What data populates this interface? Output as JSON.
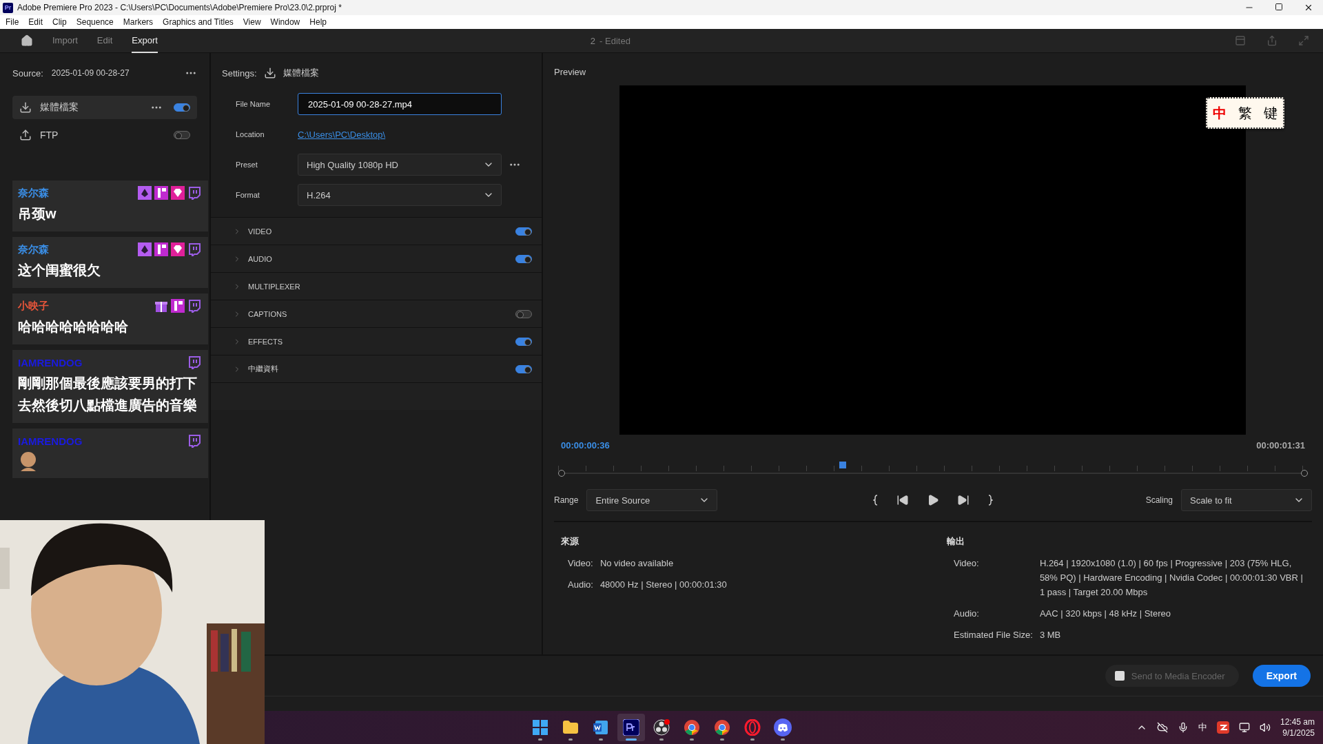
{
  "window": {
    "title": "Adobe Premiere Pro 2023 - C:\\Users\\PC\\Documents\\Adobe\\Premiere Pro\\23.0\\2.prproj *",
    "app_icon": "Pr"
  },
  "menu": [
    "File",
    "Edit",
    "Clip",
    "Sequence",
    "Markers",
    "Graphics and Titles",
    "View",
    "Window",
    "Help"
  ],
  "header": {
    "tabs": [
      {
        "label": "Import",
        "selected": false
      },
      {
        "label": "Edit",
        "selected": false
      },
      {
        "label": "Export",
        "selected": true
      }
    ],
    "document": "2",
    "status": "- Edited"
  },
  "source": {
    "label": "Source:",
    "value": "2025-01-09 00-28-27"
  },
  "destinations": [
    {
      "kind": "download",
      "label": "媒體檔案",
      "on": true,
      "selected": true
    },
    {
      "kind": "upload",
      "label": "FTP",
      "on": false,
      "selected": false
    }
  ],
  "settings": {
    "label": "Settings:",
    "destination": "媒體檔案",
    "fields": [
      {
        "kind": "input",
        "label": "File Name",
        "value": "2025-01-09 00-28-27.mp4"
      },
      {
        "kind": "link",
        "label": "Location",
        "value": "C:\\Users\\PC\\Desktop\\"
      },
      {
        "kind": "select",
        "label": "Preset",
        "value": "High Quality 1080p HD"
      },
      {
        "kind": "select",
        "label": "Format",
        "value": "H.264"
      }
    ],
    "sections": [
      {
        "label": "VIDEO",
        "on": true
      },
      {
        "label": "AUDIO",
        "on": true
      },
      {
        "label": "MULTIPLEXER"
      },
      {
        "label": "CAPTIONS",
        "on": false
      },
      {
        "label": "EFFECTS",
        "on": true
      },
      {
        "label": "中繼資料",
        "on": true
      }
    ]
  },
  "preview": {
    "title": "Preview",
    "current_time": "00:00:00:36",
    "duration": "00:00:01:31",
    "level": 0.38,
    "range": {
      "label": "Range",
      "value": "Entire Source"
    },
    "scaling": {
      "label": "Scaling",
      "value": "Scale to fit"
    }
  },
  "ime_toolbar": {
    "mode": "中",
    "script": "繁",
    "label": "键"
  },
  "source_info": {
    "title": "來源",
    "rows": [
      {
        "label": "Video:",
        "value": "No video available"
      },
      {
        "label": "Audio:",
        "value": "48000 Hz | Stereo | 00:00:01:30"
      }
    ]
  },
  "output_info": {
    "title": "輸出",
    "rows": [
      {
        "label": "Video:",
        "value": "H.264 | 1920x1080 (1.0) | 60 fps | Progressive | 203 (75% HLG, 58% PQ) | Hardware Encoding | Nvidia Codec | 00:00:01:30  VBR | 1 pass | Target 20.00 Mbps"
      },
      {
        "label": "Audio:",
        "value": "AAC | 320 kbps | 48 kHz | Stereo"
      },
      {
        "label": "Estimated File Size:",
        "value": "3 MB"
      }
    ]
  },
  "footer": {
    "send": {
      "label": "Send to Media Encoder",
      "disabled": true
    },
    "export": {
      "label": "Export"
    }
  },
  "chat": [
    {
      "user": "奈尔森",
      "color": "#3a8ee6",
      "kind": "text",
      "text": "吊颈w",
      "badges": [
        {
          "kind": "diamond"
        },
        {
          "kind": "first"
        },
        {
          "kind": "gem"
        },
        {
          "kind": "twitch"
        }
      ]
    },
    {
      "user": "奈尔森",
      "color": "#3a8ee6",
      "kind": "text",
      "text": "这个闺蜜很欠",
      "badges": [
        {
          "kind": "diamond"
        },
        {
          "kind": "first"
        },
        {
          "kind": "gem"
        },
        {
          "kind": "twitch"
        }
      ]
    },
    {
      "user": "小映子",
      "color": "#e8553a",
      "kind": "text",
      "text": "哈哈哈哈哈哈哈哈",
      "badges": [
        {
          "kind": "gift"
        },
        {
          "kind": "first"
        },
        {
          "kind": "twitch"
        }
      ]
    },
    {
      "user": "IAMRENDOG",
      "color": "#1a1ae0",
      "kind": "text",
      "text": "剛剛那個最後應該要男的打下去然後切八點檔進廣告的音樂",
      "badges": [
        {
          "kind": "twitch"
        }
      ]
    },
    {
      "user": "IAMRENDOG",
      "color": "#1a1ae0",
      "kind": "emote",
      "badges": [
        {
          "kind": "twitch"
        }
      ]
    }
  ],
  "taskbar": {
    "apps": [
      {
        "kind": "start",
        "selected": false
      },
      {
        "kind": "folder",
        "selected": false
      },
      {
        "kind": "word",
        "selected": false
      },
      {
        "kind": "premiere",
        "selected": true
      },
      {
        "kind": "obs",
        "selected": false
      },
      {
        "kind": "chrome",
        "selected": false
      },
      {
        "kind": "chrome",
        "selected": false
      },
      {
        "kind": "opera",
        "selected": false
      },
      {
        "kind": "discord",
        "selected": false
      }
    ],
    "ime": "中",
    "time": "12:45 am",
    "date": "9/1/2025"
  }
}
